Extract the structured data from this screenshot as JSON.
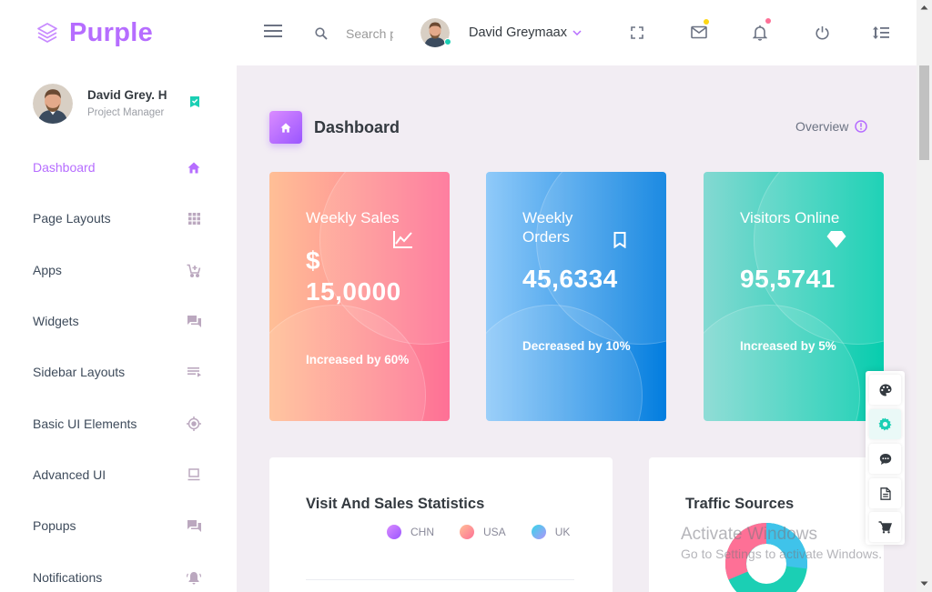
{
  "brand": {
    "name": "Purple"
  },
  "navbar": {
    "search_placeholder": "Search projects",
    "profile_name": "David Greymaax"
  },
  "sidebar": {
    "user": {
      "name": "David Grey. H",
      "role": "Project Manager"
    },
    "items": [
      {
        "label": "Dashboard",
        "icon": "home-icon",
        "active": true
      },
      {
        "label": "Page Layouts",
        "icon": "grid-icon"
      },
      {
        "label": "Apps",
        "icon": "cart-plus-icon"
      },
      {
        "label": "Widgets",
        "icon": "forum-icon"
      },
      {
        "label": "Sidebar Layouts",
        "icon": "menu-lines-icon"
      },
      {
        "label": "Basic UI Elements",
        "icon": "crosshair-icon"
      },
      {
        "label": "Advanced UI",
        "icon": "laptop-icon"
      },
      {
        "label": "Popups",
        "icon": "forum-icon"
      },
      {
        "label": "Notifications",
        "icon": "bell-ring-icon"
      }
    ]
  },
  "page": {
    "title": "Dashboard",
    "overview_label": "Overview"
  },
  "cards": [
    {
      "title": "Weekly Sales",
      "value_line1": "$",
      "value_line2": "15,0000",
      "note": "Increased by 60%",
      "icon": "chart-line-icon",
      "color_from": "#ffbf96",
      "color_to": "#fe7096"
    },
    {
      "title": "Weekly Orders",
      "value": "45,6334",
      "note": "Decreased by 10%",
      "icon": "bookmark-icon",
      "color_from": "#90caf9",
      "color_to": "#047edf"
    },
    {
      "title": "Visitors Online",
      "value": "95,5741",
      "note": "Increased by 5%",
      "icon": "diamond-icon",
      "color_from": "#84d9d2",
      "color_to": "#07cdae"
    }
  ],
  "panels": {
    "stats": {
      "title": "Visit And Sales Statistics",
      "legend": [
        {
          "label": "CHN",
          "color": "#b66dff"
        },
        {
          "label": "USA",
          "color": "#fe7096"
        },
        {
          "label": "UK",
          "color": "#57b8ff"
        }
      ]
    },
    "traffic": {
      "title": "Traffic Sources",
      "segments": [
        {
          "color": "#3fc3ea"
        },
        {
          "color": "#1bcfb4"
        },
        {
          "color": "#fe7096"
        }
      ]
    }
  },
  "watermark": {
    "line1": "Activate Windows",
    "line2": "Go to Settings to activate Windows."
  },
  "colors": {
    "primary": "#b66dff",
    "success": "#1bcfb4",
    "warning": "#fed713",
    "danger": "#fe7096"
  }
}
